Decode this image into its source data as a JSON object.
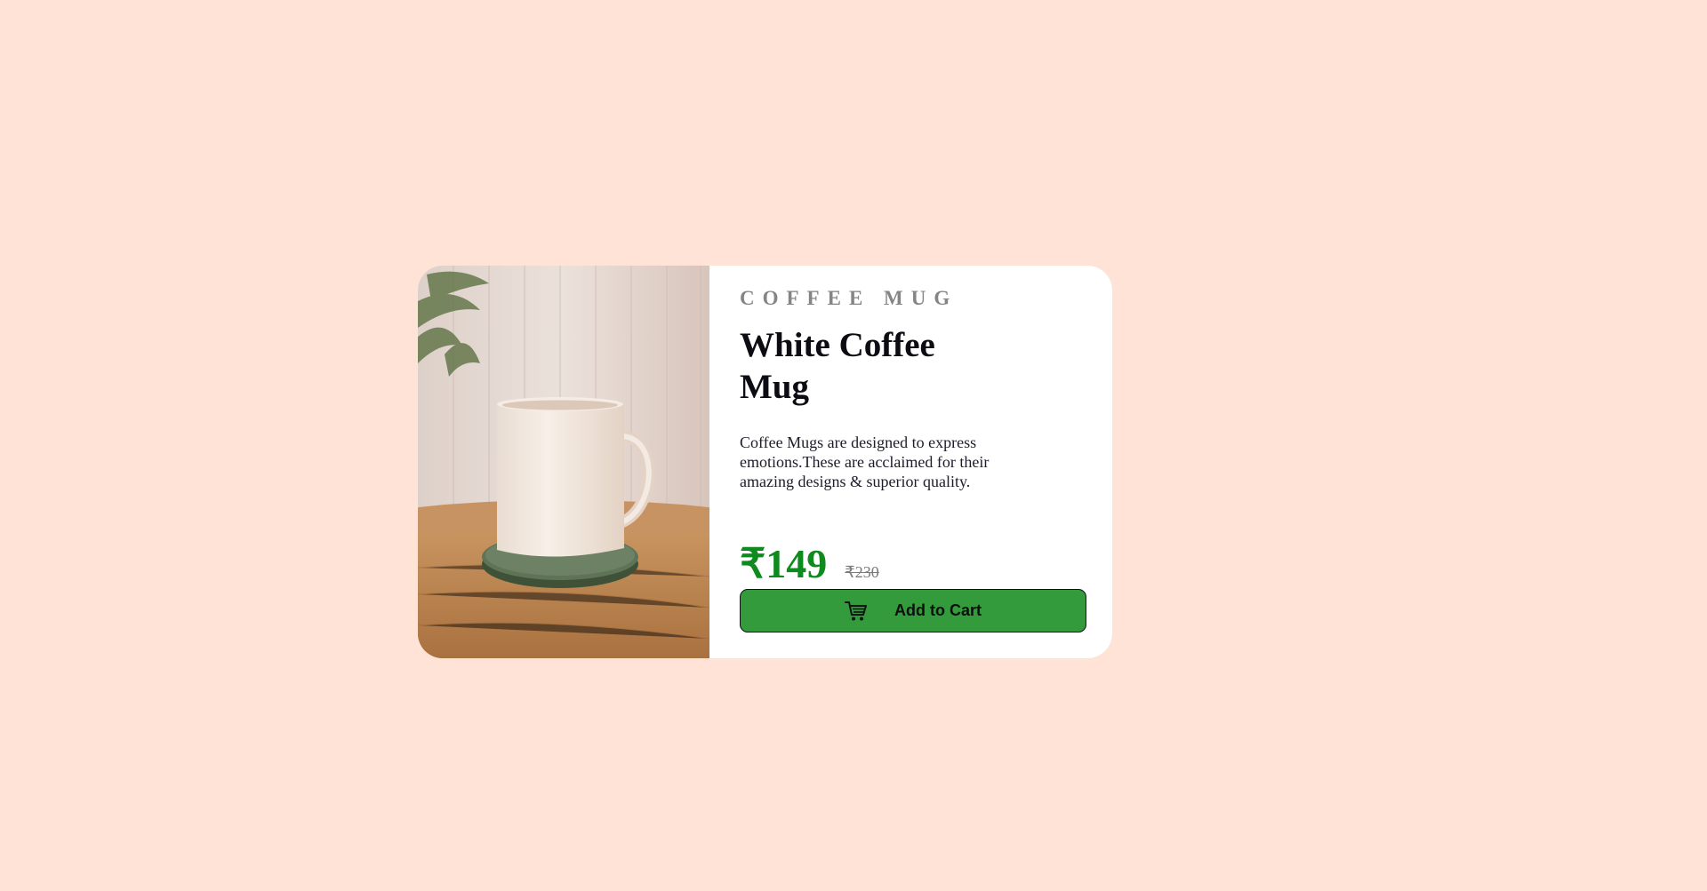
{
  "product": {
    "category": "COFFEE MUG",
    "title": "White Coffee Mug",
    "description": "Coffee Mugs are designed to express emotions.These are acclaimed for their amazing designs & superior quality.",
    "price": "₹149",
    "original_price": "₹230",
    "add_to_cart_label": "Add to Cart",
    "image_alt": "White coffee mug on a green coaster on a wooden table"
  },
  "icons": {
    "cart": "shopping-cart-icon"
  },
  "colors": {
    "page_background": "#fee3d6",
    "card_background": "#ffffff",
    "price": "#0f8a1e",
    "button": "#339b3c"
  }
}
